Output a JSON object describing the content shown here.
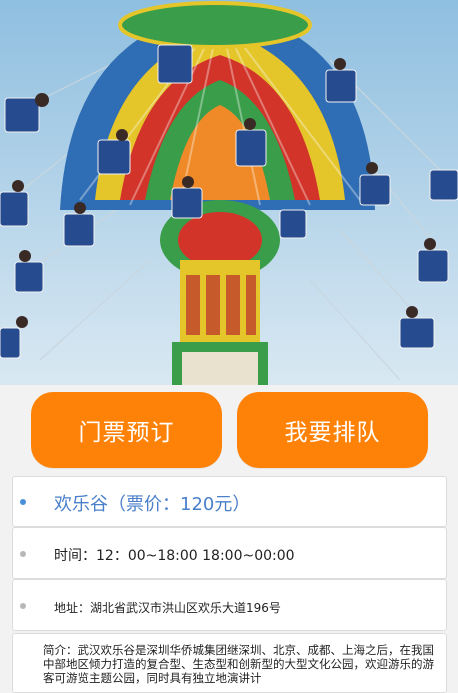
{
  "hero": {
    "alt": "Swing ride at amusement park"
  },
  "buttons": {
    "book_tickets": "门票预订",
    "join_queue": "我要排队"
  },
  "park": {
    "title": "欢乐谷（票价：120元）",
    "hours": "时间：12：00~18:00 18:00~00:00",
    "address": "地址：湖北省武汉市洪山区欢乐大道196号",
    "intro": "简介：武汉欢乐谷是深圳华侨城集团继深圳、北京、成都、上海之后，在我国中部地区倾力打造的复合型、生态型和创新型的大型文化公园，欢迎游乐的游客可游览主题公园，同时具有独立地演讲计"
  },
  "colors": {
    "button": "#ff8208",
    "title": "#4a7fc9",
    "active_dot": "#4a90d9"
  }
}
